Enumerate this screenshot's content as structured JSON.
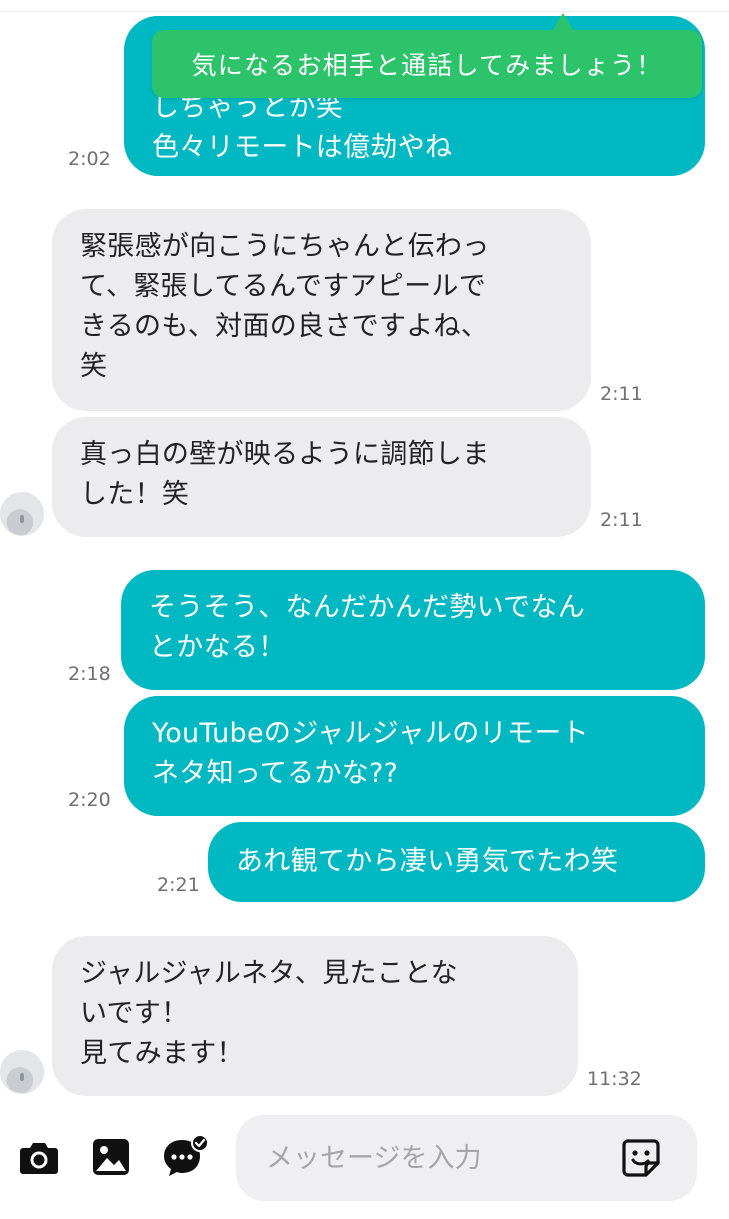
{
  "tooltip": {
    "text": "気になるお相手と通話してみましょう！"
  },
  "messages": [
    {
      "side": "out",
      "text": "しちゃうとか笑\n色々リモートは億劫やね",
      "time": "2:02"
    },
    {
      "side": "in",
      "text": "緊張感が向こうにちゃんと伝わっ\nて、緊張してるんですアピールで\nきるのも、対面の良さですよね、\n笑",
      "time": "2:11"
    },
    {
      "side": "in",
      "text": "真っ白の壁が映るように調節しま\nした！笑",
      "time": "2:11"
    },
    {
      "side": "out",
      "text": "そうそう、なんだかんだ勢いでなん\nとかなる！",
      "time": "2:18"
    },
    {
      "side": "out",
      "text": "YouTubeのジャルジャルのリモート\nネタ知ってるかな??",
      "time": "2:20"
    },
    {
      "side": "out",
      "text": "あれ観てから凄い勇気でたわ笑",
      "time": "2:21"
    },
    {
      "side": "in",
      "text": "ジャルジャルネタ、見たことな\nいです！\n見てみます！",
      "time": "11:32"
    }
  ],
  "input": {
    "placeholder": "メッセージを入力"
  },
  "icons": {
    "camera": "camera-icon",
    "image": "image-icon",
    "chat_check": "chat-check-icon",
    "sticker": "sticker-icon"
  },
  "colors": {
    "outgoing_bubble": "#00b8c2",
    "incoming_bubble": "#ececef",
    "tooltip": "#2dc36a"
  }
}
